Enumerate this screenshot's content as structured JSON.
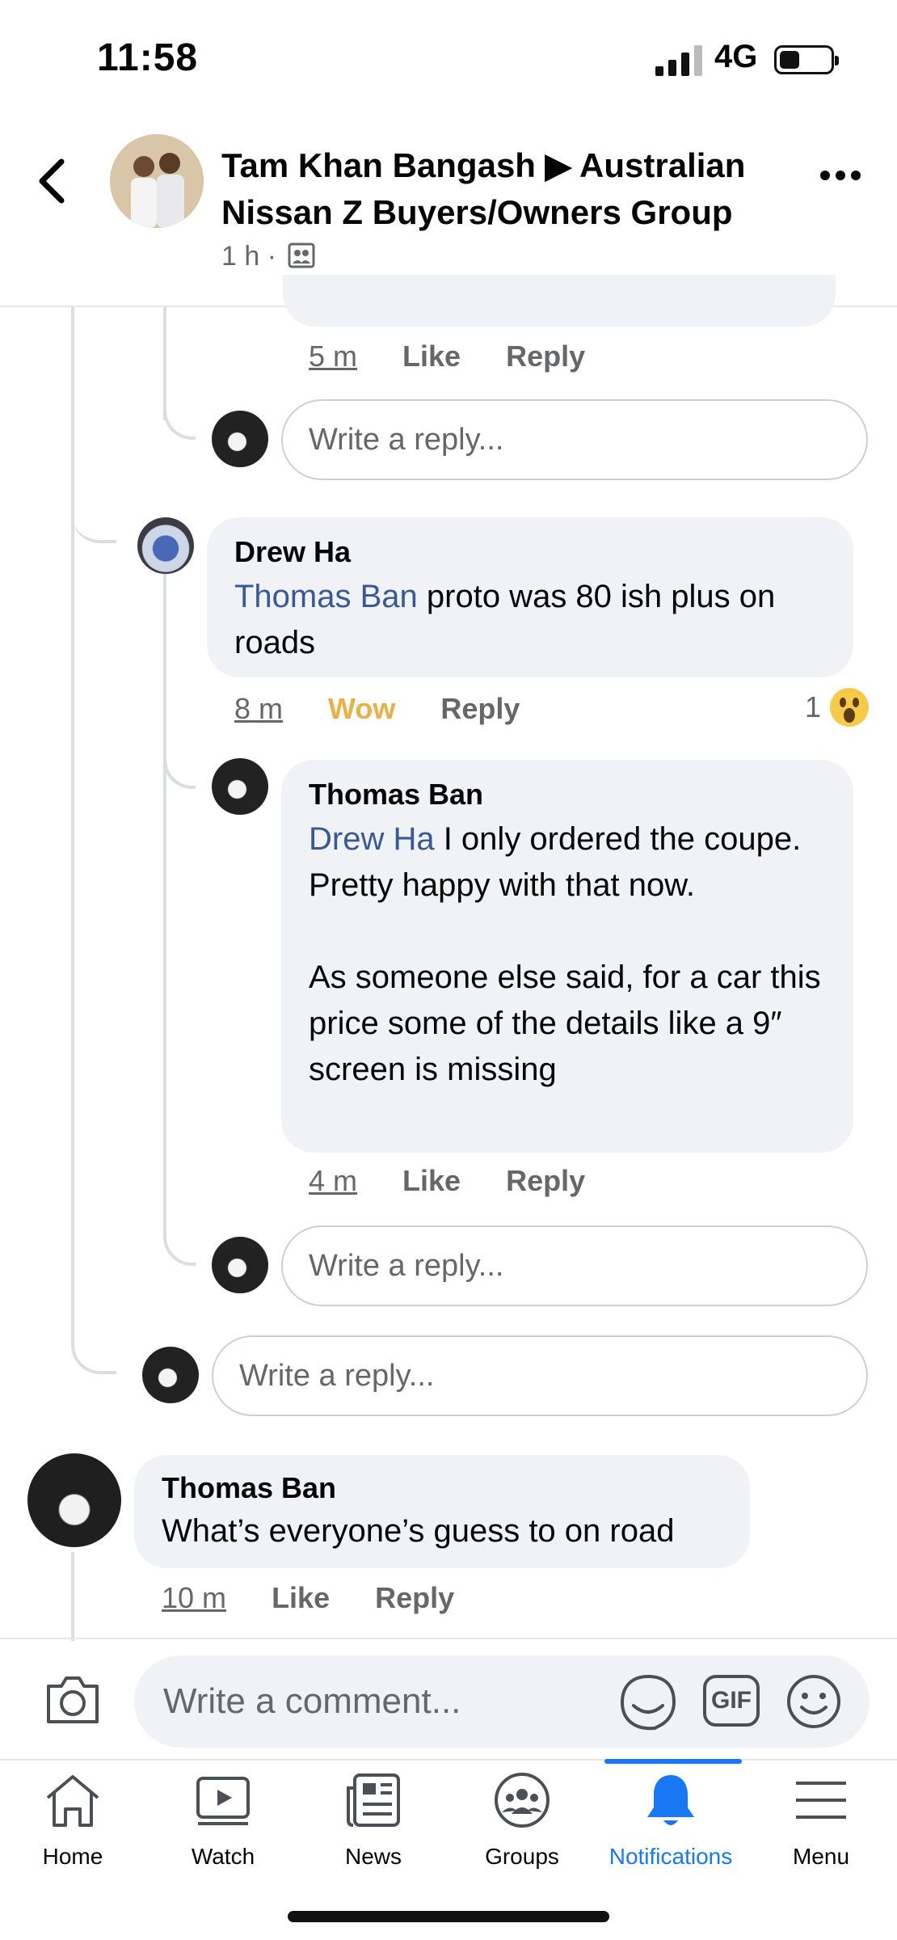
{
  "status_bar": {
    "time": "11:58",
    "network": "4G"
  },
  "header": {
    "title": "Tam Khan Bangash ▶ Australian Nissan Z Buyers/Owners Group",
    "meta": "1 h ·"
  },
  "thread": {
    "top_actions": {
      "time": "5 m",
      "like": "Like",
      "reply": "Reply"
    },
    "reply_placeholder": "Write a reply...",
    "drew_comment": {
      "author": "Drew Ha",
      "mention": "Thomas Ban",
      "text": " proto was 80 ish plus on roads",
      "time": "8 m",
      "reaction_label": "Wow",
      "reply": "Reply",
      "reaction_count": "1"
    },
    "thomas_reply": {
      "author": "Thomas Ban",
      "mention": "Drew Ha",
      "text_line1": "  I only ordered the coupe.  Pretty happy with that now.",
      "text_line2": "As someone else said, for a car this price some of the details like a 9″ screen is missing",
      "time": "4 m",
      "like": "Like",
      "reply": "Reply"
    },
    "thomas_top_comment": {
      "author": "Thomas Ban",
      "text": "What’s everyone’s guess to on road",
      "time": "10 m",
      "like": "Like",
      "reply": "Reply"
    }
  },
  "composer": {
    "placeholder": "Write a comment...",
    "gif": "GIF"
  },
  "nav": {
    "items": [
      {
        "label": "Home",
        "icon": "home-icon"
      },
      {
        "label": "Watch",
        "icon": "watch-icon"
      },
      {
        "label": "News",
        "icon": "news-icon"
      },
      {
        "label": "Groups",
        "icon": "groups-icon"
      },
      {
        "label": "Notifications",
        "icon": "bell-icon",
        "active": true
      },
      {
        "label": "Menu",
        "icon": "menu-icon"
      }
    ]
  },
  "colors": {
    "accent": "#1877f2",
    "mention": "#385898",
    "wow": "#e7b04a",
    "bubble": "#f0f2f5"
  }
}
